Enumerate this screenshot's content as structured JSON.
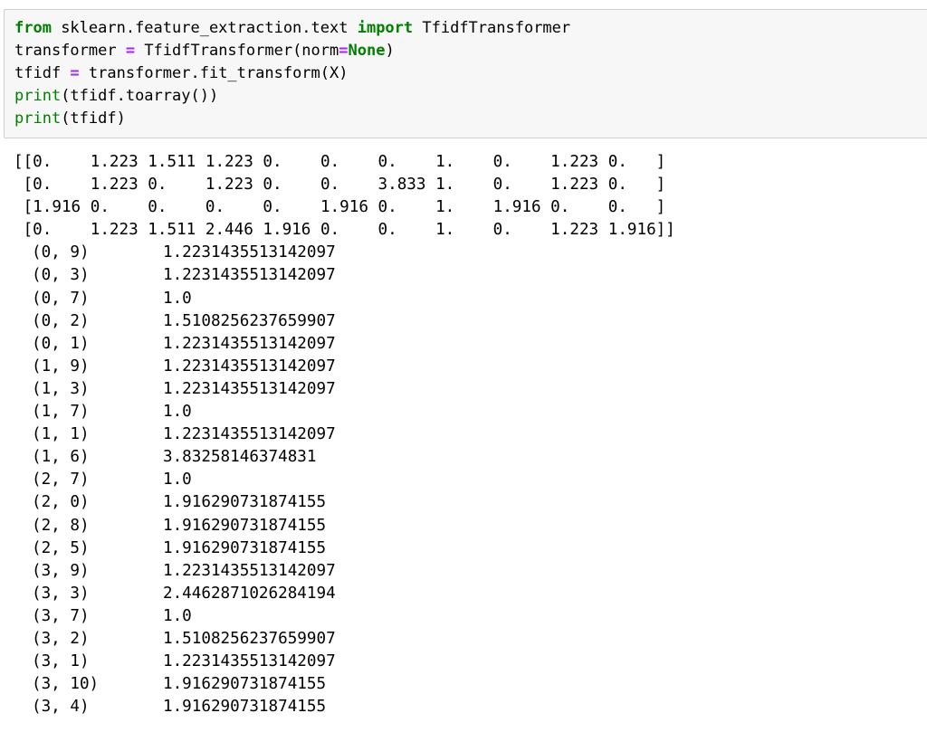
{
  "code_cell": {
    "lines": [
      [
        {
          "t": "from",
          "c": "kw"
        },
        {
          "t": " sklearn.feature_extraction.text ",
          "c": ""
        },
        {
          "t": "import",
          "c": "kw"
        },
        {
          "t": " TfidfTransformer",
          "c": ""
        }
      ],
      [
        {
          "t": "transformer ",
          "c": ""
        },
        {
          "t": "=",
          "c": "op"
        },
        {
          "t": " TfidfTransformer(norm",
          "c": ""
        },
        {
          "t": "=",
          "c": "op"
        },
        {
          "t": "None",
          "c": "cn"
        },
        {
          "t": ")",
          "c": ""
        }
      ],
      [
        {
          "t": "tfidf ",
          "c": ""
        },
        {
          "t": "=",
          "c": "op"
        },
        {
          "t": " transformer.fit_transform(X)",
          "c": ""
        }
      ],
      [
        {
          "t": "print",
          "c": "bi"
        },
        {
          "t": "(tfidf.toarray())",
          "c": ""
        }
      ],
      [
        {
          "t": "print",
          "c": "bi"
        },
        {
          "t": "(tfidf)",
          "c": ""
        }
      ]
    ]
  },
  "output": {
    "array_lines": [
      "[[0.    1.223 1.511 1.223 0.    0.    0.    1.    0.    1.223 0.   ]",
      " [0.    1.223 0.    1.223 0.    0.    3.833 1.    0.    1.223 0.   ]",
      " [1.916 0.    0.    0.    0.    1.916 0.    1.    1.916 0.    0.   ]",
      " [0.    1.223 1.511 2.446 1.916 0.    0.    1.    0.    1.223 1.916]]"
    ],
    "sparse_entries": [
      {
        "index": "(0, 9)",
        "value": "1.2231435513142097"
      },
      {
        "index": "(0, 3)",
        "value": "1.2231435513142097"
      },
      {
        "index": "(0, 7)",
        "value": "1.0"
      },
      {
        "index": "(0, 2)",
        "value": "1.5108256237659907"
      },
      {
        "index": "(0, 1)",
        "value": "1.2231435513142097"
      },
      {
        "index": "(1, 9)",
        "value": "1.2231435513142097"
      },
      {
        "index": "(1, 3)",
        "value": "1.2231435513142097"
      },
      {
        "index": "(1, 7)",
        "value": "1.0"
      },
      {
        "index": "(1, 1)",
        "value": "1.2231435513142097"
      },
      {
        "index": "(1, 6)",
        "value": "3.83258146374831"
      },
      {
        "index": "(2, 7)",
        "value": "1.0"
      },
      {
        "index": "(2, 0)",
        "value": "1.916290731874155"
      },
      {
        "index": "(2, 8)",
        "value": "1.916290731874155"
      },
      {
        "index": "(2, 5)",
        "value": "1.916290731874155"
      },
      {
        "index": "(3, 9)",
        "value": "1.2231435513142097"
      },
      {
        "index": "(3, 3)",
        "value": "2.4462871026284194"
      },
      {
        "index": "(3, 7)",
        "value": "1.0"
      },
      {
        "index": "(3, 2)",
        "value": "1.5108256237659907"
      },
      {
        "index": "(3, 1)",
        "value": "1.2231435513142097"
      },
      {
        "index": "(3, 10)",
        "value": "1.916290731874155"
      },
      {
        "index": "(3, 4)",
        "value": "1.916290731874155"
      }
    ]
  }
}
